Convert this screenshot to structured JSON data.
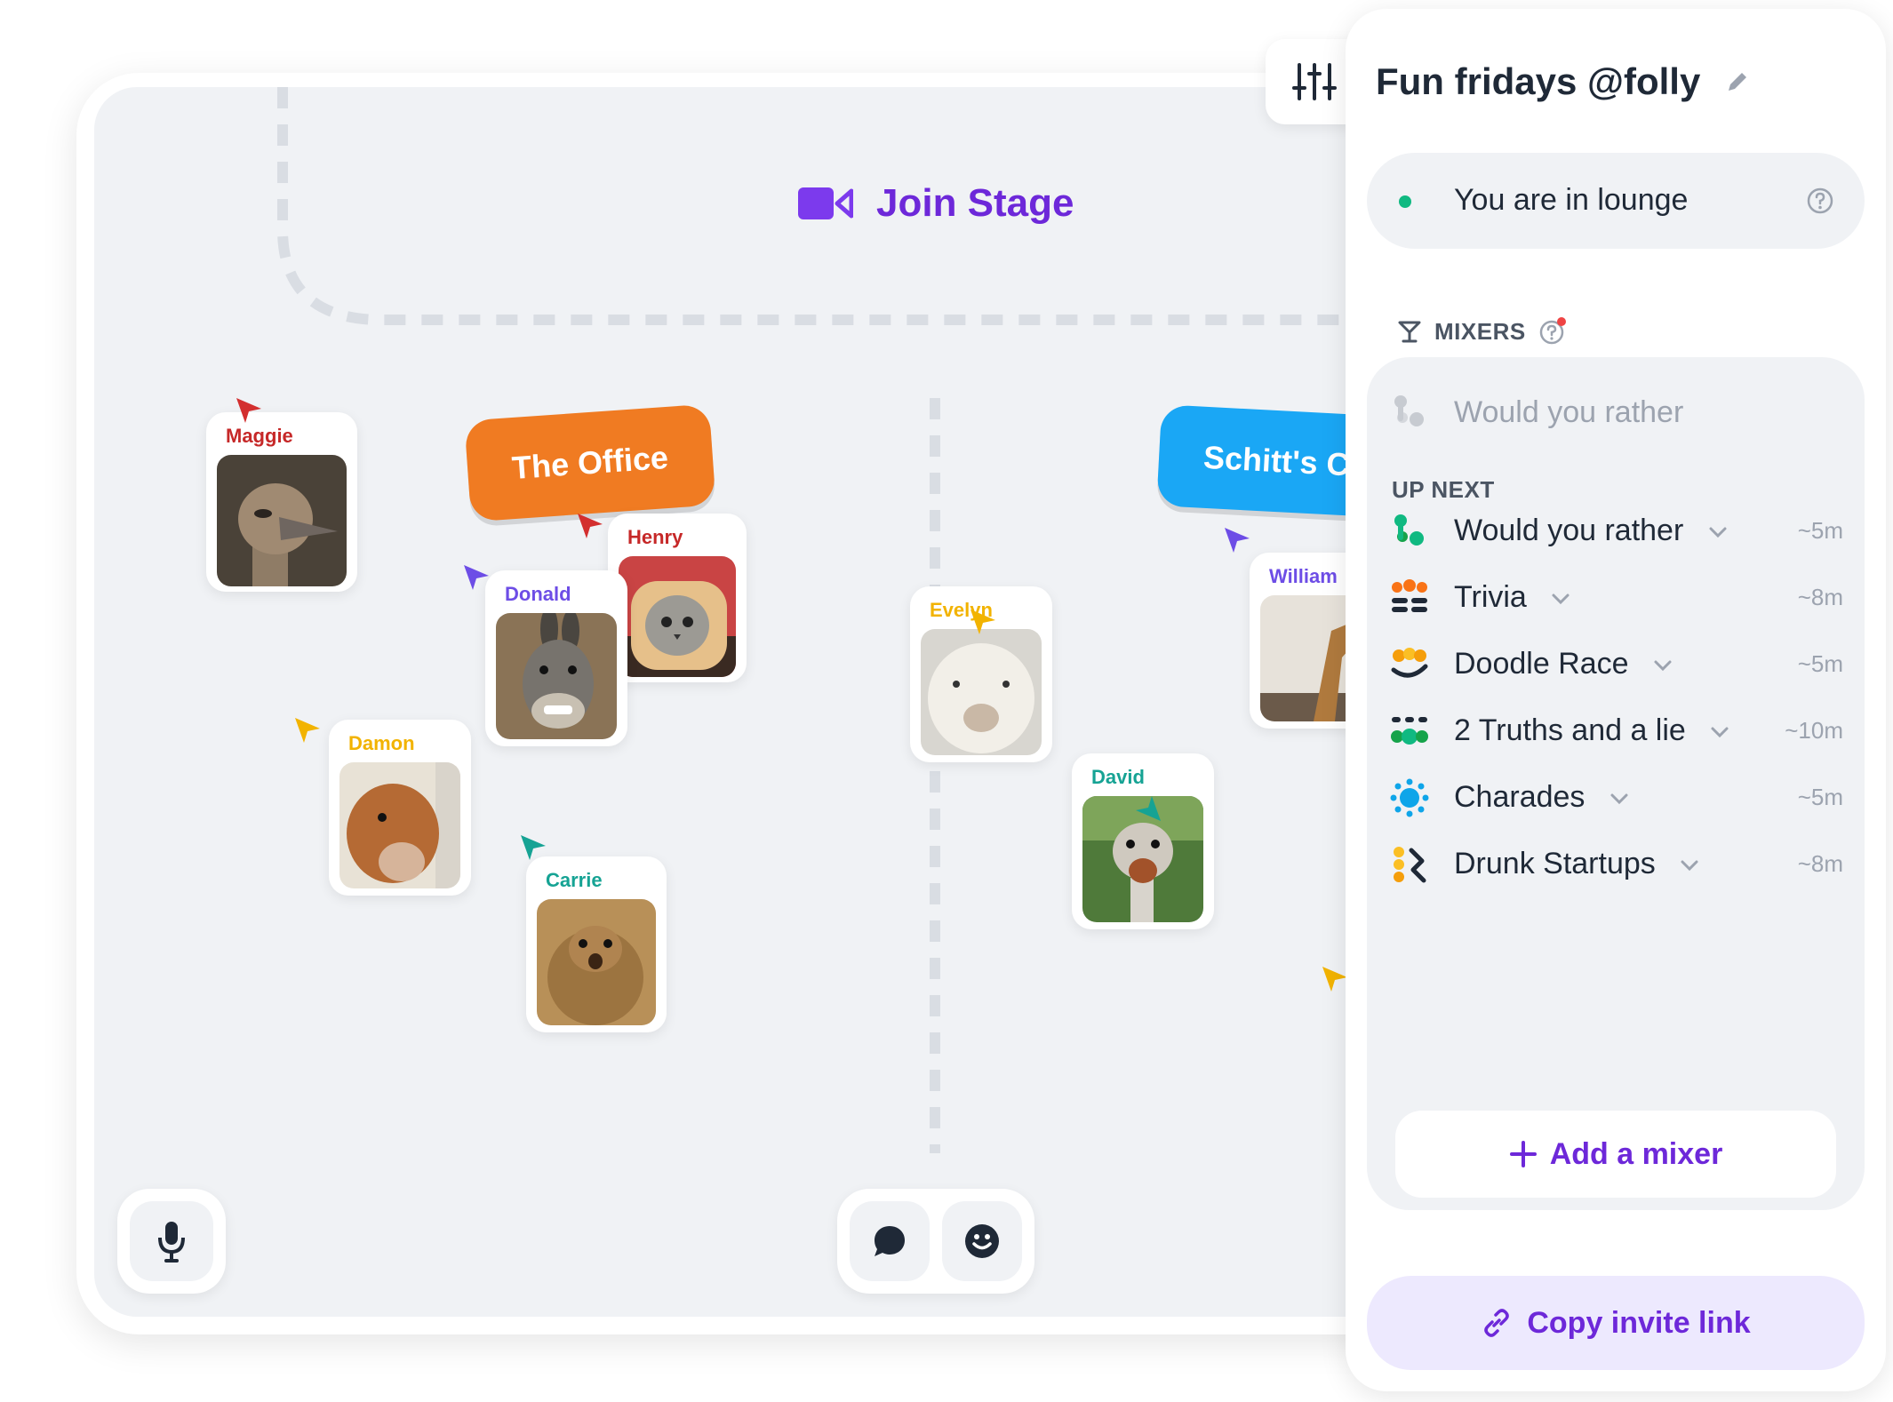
{
  "stage": {
    "join_stage_label": "Join Stage",
    "rooms": [
      {
        "label": "The Office",
        "color": "#f07b22"
      },
      {
        "label": "Schitt's Creek",
        "color": "#1aa7f5"
      }
    ],
    "people": [
      {
        "name": "Maggie",
        "color": "#c62828",
        "animal": "ostrich"
      },
      {
        "name": "Henry",
        "color": "#c62828",
        "animal": "cat"
      },
      {
        "name": "Donald",
        "color": "#6d4de6",
        "animal": "donkey"
      },
      {
        "name": "Damon",
        "color": "#f2b300",
        "animal": "goat"
      },
      {
        "name": "Carrie",
        "color": "#16a394",
        "animal": "prairie-dog"
      },
      {
        "name": "Evelyn",
        "color": "#f2b300",
        "animal": "alpaca"
      },
      {
        "name": "William",
        "color": "#6d4de6",
        "animal": "giraffe"
      },
      {
        "name": "David",
        "color": "#16a394",
        "animal": "ostrich"
      }
    ]
  },
  "panel": {
    "title": "Fun fridays @folly",
    "lounge_status": "You are in lounge",
    "mixers_heading": "MIXERS",
    "current_mixer": "Would you rather",
    "up_next_label": "UP NEXT",
    "mixers": [
      {
        "name": "Would you rather",
        "duration": "~5m",
        "icon": "would-you-rather-icon"
      },
      {
        "name": "Trivia",
        "duration": "~8m",
        "icon": "trivia-icon"
      },
      {
        "name": "Doodle Race",
        "duration": "~5m",
        "icon": "doodle-race-icon"
      },
      {
        "name": "2 Truths and a lie",
        "duration": "~10m",
        "icon": "two-truths-icon"
      },
      {
        "name": "Charades",
        "duration": "~5m",
        "icon": "charades-icon"
      },
      {
        "name": "Drunk Startups",
        "duration": "~8m",
        "icon": "drunk-startups-icon"
      }
    ],
    "add_mixer_label": "Add a mixer",
    "copy_invite_label": "Copy invite link"
  },
  "colors": {
    "accent": "#6d28d9",
    "lounge_dot": "#10b981",
    "canvas": "#f0f2f5"
  }
}
